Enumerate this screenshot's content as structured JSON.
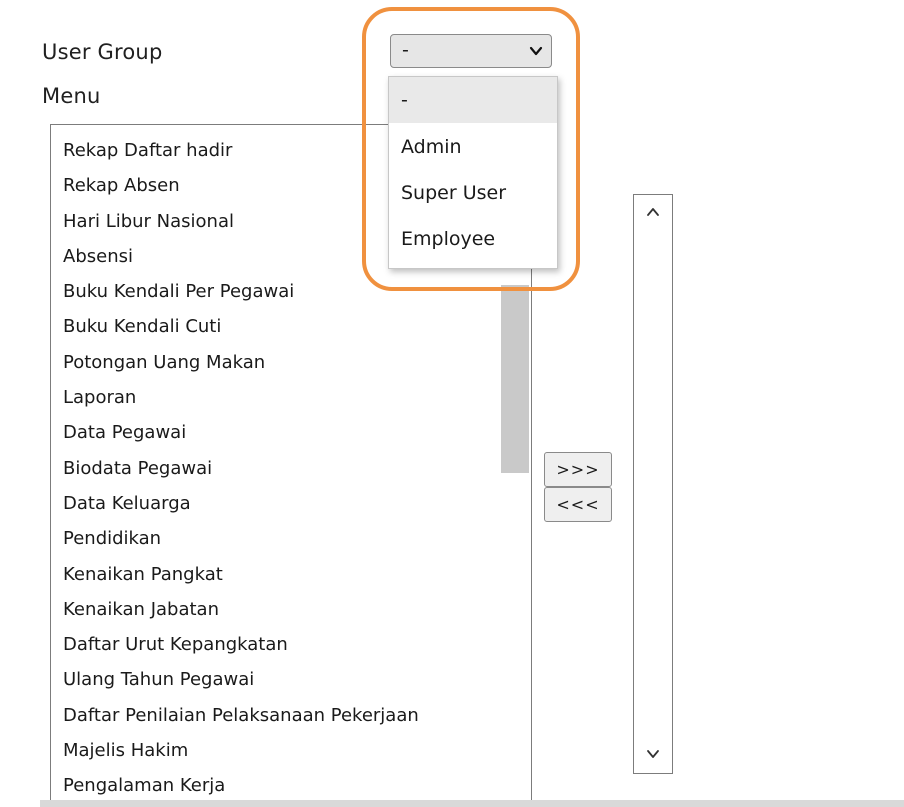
{
  "form": {
    "user_group_label": "User Group",
    "menu_label": "Menu"
  },
  "select": {
    "value": "-",
    "icon": "chevron-down-icon"
  },
  "dropdown": {
    "options": [
      "-",
      "Admin",
      "Super User",
      "Employee"
    ],
    "selected_index": 0,
    "highlight_color": "#f0913f"
  },
  "menu_list": {
    "items": [
      "Rekap Daftar hadir",
      "Rekap Absen",
      "Hari Libur Nasional",
      "Absensi",
      "Buku Kendali Per Pegawai",
      "Buku Kendali Cuti",
      "Potongan Uang Makan",
      "Laporan",
      "Data Pegawai",
      "Biodata Pegawai",
      "Data Keluarga",
      "Pendidikan",
      "Kenaikan Pangkat",
      "Kenaikan Jabatan",
      "Daftar Urut Kepangkatan",
      "Ulang Tahun Pegawai",
      "Daftar Penilaian Pelaksanaan Pekerjaan",
      "Majelis Hakim",
      "Pengalaman Kerja"
    ]
  },
  "buttons": {
    "add_label": ">>>",
    "remove_label": "<<<"
  },
  "selected_list": {
    "items": [],
    "scroll_up_icon": "chevron-up-icon",
    "scroll_down_icon": "chevron-down-icon"
  }
}
